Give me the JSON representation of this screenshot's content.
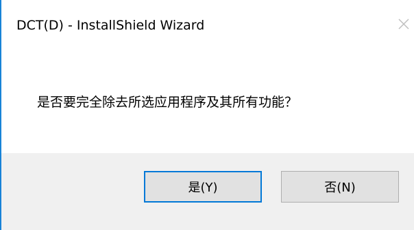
{
  "window": {
    "title": "DCT(D) - InstallShield Wizard",
    "close_icon": "close-icon"
  },
  "dialog": {
    "message": "是否要完全除去所选应用程序及其所有功能？"
  },
  "buttons": {
    "yes_label": "是(Y)",
    "no_label": "否(N)"
  },
  "colors": {
    "accent_border": "#1883d7",
    "default_button_border": "#0078d7",
    "footer_bg": "#f0f0f0",
    "button_bg": "#e1e1e1"
  }
}
